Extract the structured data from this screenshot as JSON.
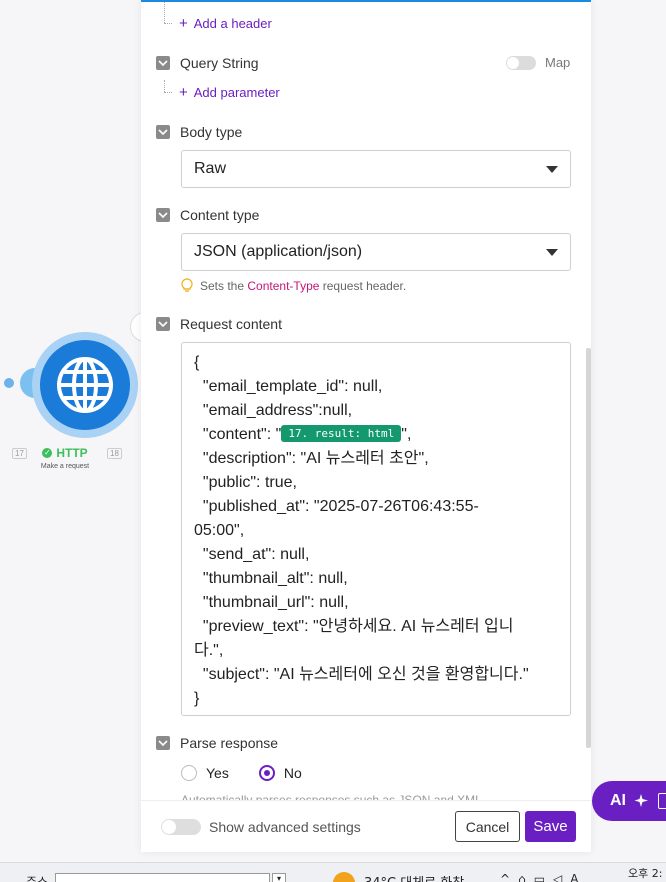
{
  "canvas": {
    "module": {
      "title": "HTTP",
      "subtitle": "Make a request",
      "badge_left": "17",
      "badge_right": "18"
    }
  },
  "panel": {
    "headers": {
      "add_label": "Add a header"
    },
    "query_string": {
      "title": "Query String",
      "map_label": "Map",
      "add_label": "Add parameter"
    },
    "body_type": {
      "title": "Body type",
      "value": "Raw"
    },
    "content_type": {
      "title": "Content type",
      "value": "JSON (application/json)",
      "hint_prefix": "Sets the",
      "hint_code": "Content-Type",
      "hint_suffix": "request header."
    },
    "request_content": {
      "title": "Request content",
      "line1": "{",
      "line2": "  \"email_template_id\": null,",
      "line3": "  \"email_address\":null,",
      "line4_prefix": "  \"content\": \"",
      "line4_pill": "17. result: html",
      "line4_suffix": "\",",
      "line5": "  \"description\": \"AI 뉴스레터 초안\",",
      "line6": "  \"public\": true,",
      "line7": "  \"published_at\": \"2025-07-26T06:43:55-\n05:00\",",
      "line8": "  \"send_at\": null,",
      "line9": "  \"thumbnail_alt\": null,",
      "line10": "  \"thumbnail_url\": null,",
      "line11": "  \"preview_text\": \"안녕하세요. AI 뉴스레터 입니\n다.\",",
      "line12": "  \"subject\": \"AI 뉴스레터에 오신 것을 환영합니다.\"",
      "line13": "}"
    },
    "parse_response": {
      "title": "Parse response",
      "option_yes": "Yes",
      "option_no": "No",
      "selected": "No",
      "hint_partial": "Automatically parses responses such as JSON and XML"
    },
    "footer": {
      "advanced_label": "Show advanced settings",
      "cancel_label": "Cancel",
      "save_label": "Save"
    }
  },
  "ai_button": {
    "label": "AI"
  },
  "taskbar": {
    "address_label": "주소",
    "weather": "34°C 대체로 화창",
    "clock": "오후 2:"
  },
  "colors": {
    "accent": "#6a1fc2",
    "module_blue": "#1a7bd8",
    "pill_green": "#14996e",
    "status_green": "#3cbf5c",
    "hint_code": "#c2187a"
  }
}
